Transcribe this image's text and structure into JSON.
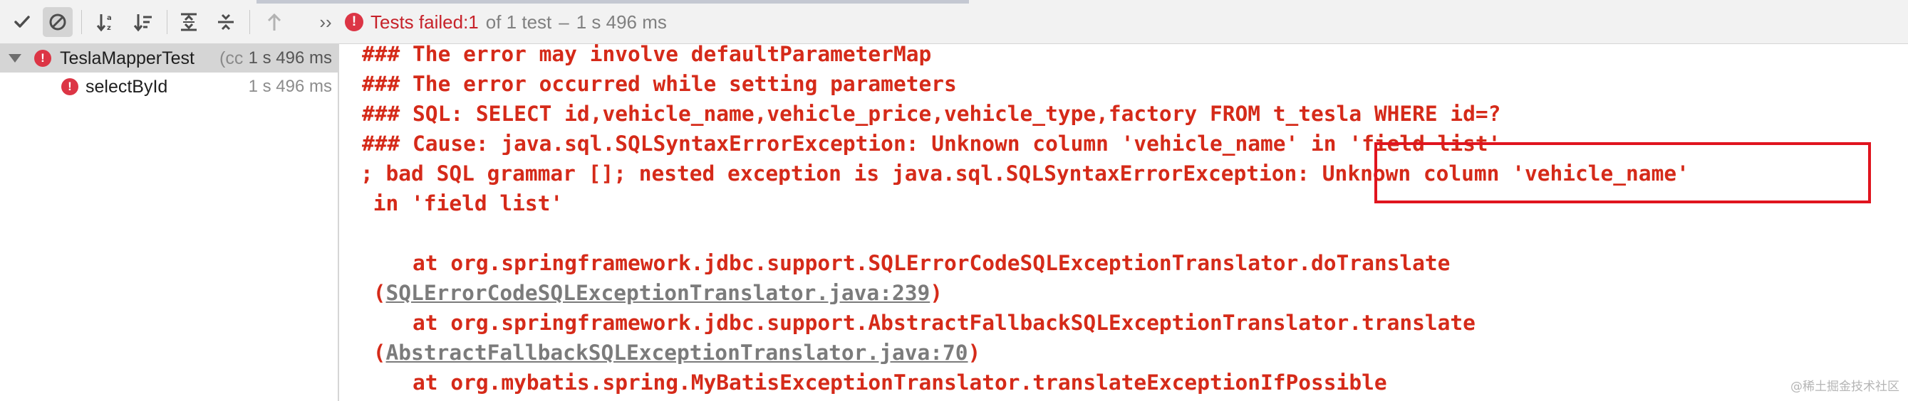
{
  "toolbar": {
    "buttons": [
      {
        "name": "show-passed",
        "icon": "checkmark-icon"
      },
      {
        "name": "show-ignored",
        "icon": "ignored-icon",
        "active": true
      },
      {
        "name": "sort-alphabetically",
        "icon": "sort-alpha-icon"
      },
      {
        "name": "sort-by-duration",
        "icon": "sort-duration-icon"
      },
      {
        "name": "expand-all",
        "icon": "expand-all-icon"
      },
      {
        "name": "collapse-all",
        "icon": "collapse-all-icon"
      },
      {
        "name": "previous-failed",
        "icon": "arrow-up-icon"
      },
      {
        "name": "more",
        "icon": "more-chevrons-icon"
      }
    ],
    "more_label": "››"
  },
  "status": {
    "icon": "error-icon",
    "failed_label": "Tests failed: ",
    "failed_count": "1",
    "total_text": "of 1 test",
    "dash": "–",
    "duration": "1 s 496 ms"
  },
  "tree": {
    "root": {
      "name": "TeslaMapperTest",
      "sub": "(cc",
      "time": "1 s 496 ms",
      "icon": "error-icon"
    },
    "child": {
      "name": "selectById",
      "time": "1 s 496 ms",
      "icon": "error-icon"
    }
  },
  "console": {
    "lines": [
      "### The error may involve defaultParameterMap",
      "### The error occurred while setting parameters",
      "### SQL: SELECT id,vehicle_name,vehicle_price,vehicle_type,factory FROM t_tesla WHERE id=?",
      "### Cause: java.sql.SQLSyntaxErrorException: Unknown column 'vehicle_name' in 'field list'",
      "; bad SQL grammar []; nested exception is java.sql.SQLSyntaxErrorException: Unknown column 'vehicle_name'",
      " in 'field list'",
      "",
      "    at org.springframework.jdbc.support.SQLErrorCodeSQLExceptionTranslator.doTranslate",
      "    at org.springframework.jdbc.support.AbstractFallbackSQLExceptionTranslator.translate",
      "    at org.mybatis.spring.MyBatisExceptionTranslator.translateExceptionIfPossible"
    ],
    "trace_links": [
      {
        "open": " (",
        "link": "SQLErrorCodeSQLExceptionTranslator.java:239",
        "close": ")"
      },
      {
        "open": " (",
        "link": "AbstractFallbackSQLExceptionTranslator.java:70",
        "close": ")"
      }
    ]
  },
  "colors": {
    "error_text": "#d52a19",
    "link_text": "#7b7b7b",
    "highlight_box": "#e0141e",
    "error_icon": "#dc3545"
  },
  "watermark": "@稀土掘金技术社区"
}
